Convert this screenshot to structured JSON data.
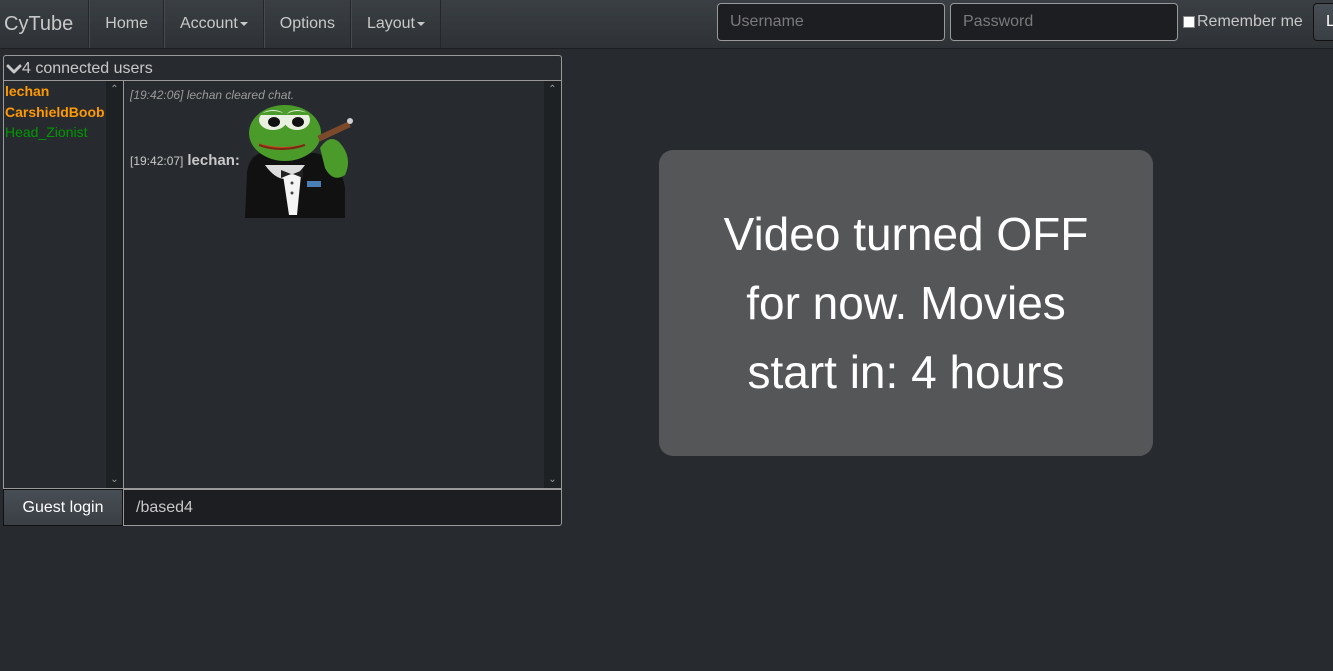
{
  "navbar": {
    "brand": "CyTube",
    "items": [
      {
        "label": "Home"
      },
      {
        "label": "Account"
      },
      {
        "label": "Options"
      },
      {
        "label": "Layout"
      }
    ],
    "username_placeholder": "Username",
    "password_placeholder": "Password",
    "remember_label": "Remember me",
    "login_label": "L"
  },
  "chat": {
    "header": "4 connected users",
    "users": [
      {
        "name": "lechan",
        "rank": "admin"
      },
      {
        "name": "CarshieldBoob",
        "rank": "admin"
      },
      {
        "name": "Head_Zionist",
        "rank": "guest"
      }
    ],
    "messages": [
      {
        "text": "[19:42:06] lechan cleared chat."
      },
      {
        "timestamp": "[19:42:07]",
        "user": "lechan:",
        "image": "pepe-cigar-image"
      }
    ],
    "guest_login_label": "Guest login",
    "input_value": "/based4"
  },
  "video": {
    "message": "Video turned OFF for now. Movies start in: 4 hours"
  },
  "colors": {
    "background": "#272b30",
    "admin_user": "#ff9900",
    "guest_user": "#009900",
    "panel": "#555658"
  }
}
